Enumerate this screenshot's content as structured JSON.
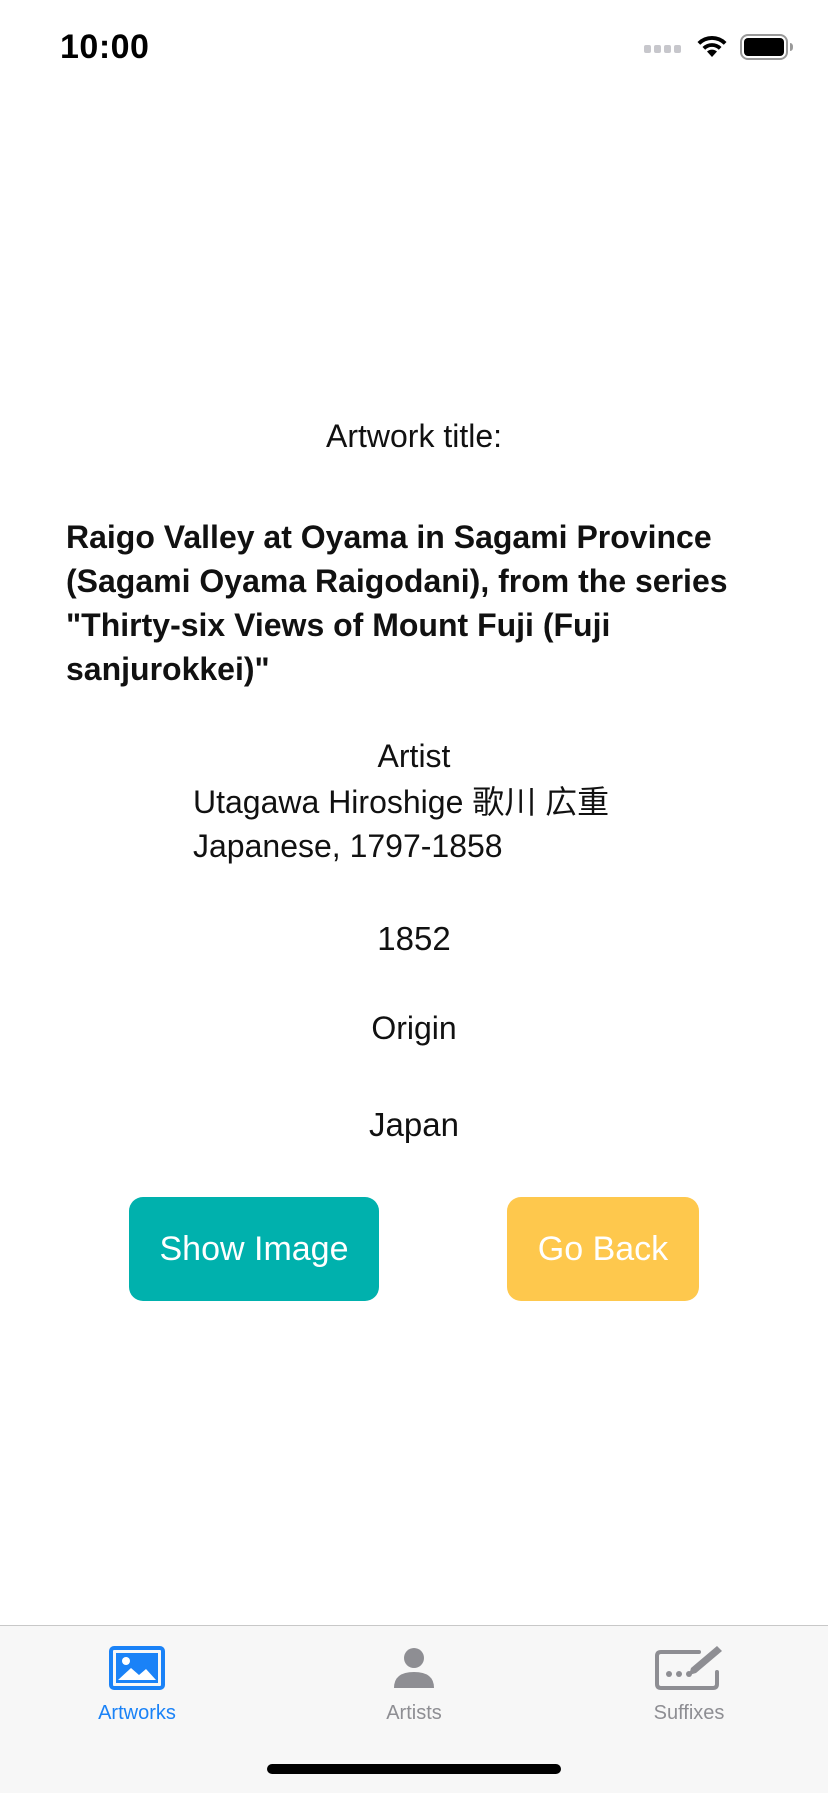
{
  "status_bar": {
    "time": "10:00",
    "icons": [
      "signal-icon",
      "wifi-icon",
      "battery-icon"
    ]
  },
  "detail": {
    "title_label": "Artwork title:",
    "title_value": "Raigo Valley at Oyama in Sagami Province (Sagami Oyama Raigodani), from the series \"Thirty-six Views of Mount Fuji (Fuji sanjurokkei)\"",
    "artist_label": "Artist",
    "artist_value": "Utagawa Hiroshige 歌川 広重\nJapanese, 1797-1858",
    "date_value": "1852",
    "origin_label": "Origin",
    "origin_value": "Japan"
  },
  "buttons": {
    "show_image": "Show Image",
    "go_back": "Go Back"
  },
  "tab_bar": {
    "tabs": [
      {
        "label": "Artworks",
        "icon": "photo-icon",
        "active": true
      },
      {
        "label": "Artists",
        "icon": "person-icon",
        "active": false
      },
      {
        "label": "Suffixes",
        "icon": "keyboard-pencil-icon",
        "active": false
      }
    ]
  },
  "colors": {
    "show_image_button": "#00b1ad",
    "go_back_button": "#fec84d",
    "active_tab": "#1a82f7",
    "inactive_tab": "#8e8e93"
  }
}
